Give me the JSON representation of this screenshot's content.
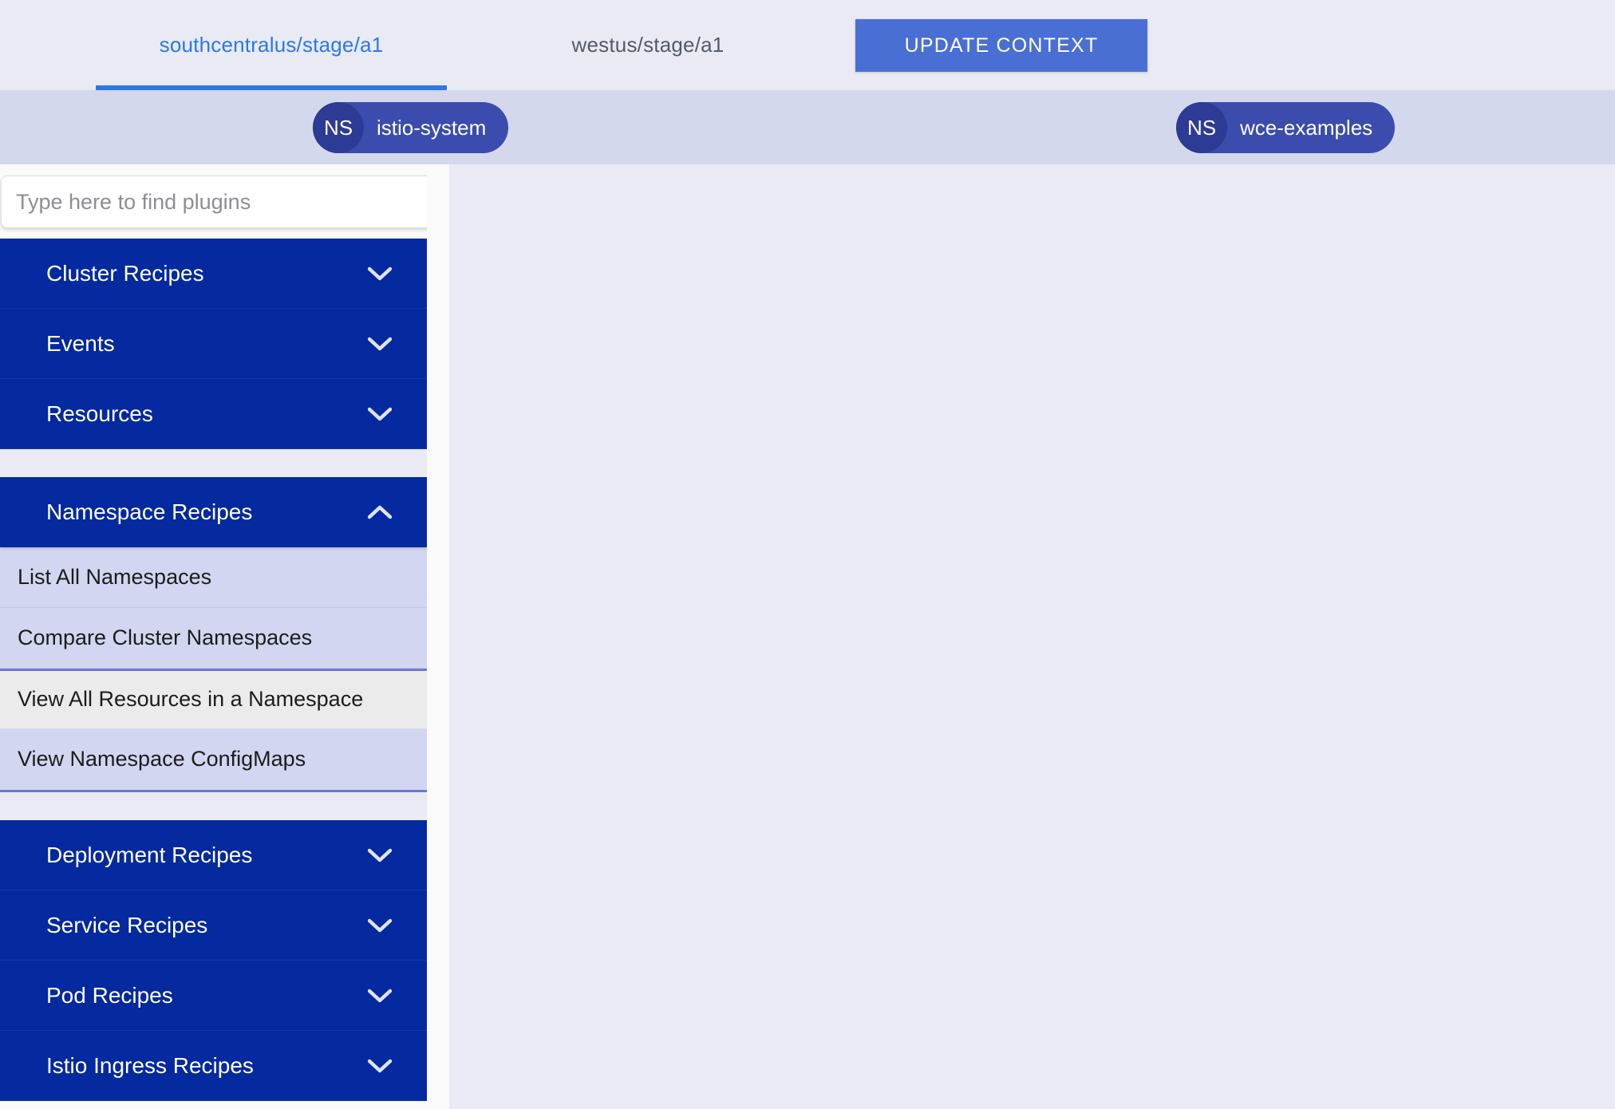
{
  "tabs": [
    {
      "label": "southcentralus/stage/a1",
      "active": true
    },
    {
      "label": "westus/stage/a1",
      "active": false
    }
  ],
  "toolbar": {
    "update_context_label": "UPDATE CONTEXT"
  },
  "namespace_bar": {
    "chips": [
      {
        "avatar": "NS",
        "label": "istio-system"
      },
      {
        "avatar": "NS",
        "label": "wce-examples"
      }
    ]
  },
  "sidebar": {
    "search": {
      "placeholder": "Type here to find plugins",
      "value": ""
    },
    "groups": [
      {
        "label": "Cluster Recipes",
        "expanded": false,
        "chevron": "chevron-down-icon",
        "items": []
      },
      {
        "label": "Events",
        "expanded": false,
        "chevron": "chevron-down-icon",
        "items": []
      },
      {
        "label": "Resources",
        "expanded": false,
        "chevron": "chevron-down-icon",
        "items": []
      },
      {
        "label": "Namespace Recipes",
        "expanded": true,
        "chevron": "chevron-up-icon",
        "items": [
          {
            "label": "List All Namespaces",
            "hovered": false
          },
          {
            "label": "Compare Cluster Namespaces",
            "hovered": false
          },
          {
            "label": "View All Resources in a Namespace",
            "hovered": true
          },
          {
            "label": "View Namespace ConfigMaps",
            "hovered": false
          }
        ]
      },
      {
        "label": "Deployment Recipes",
        "expanded": false,
        "chevron": "chevron-down-icon",
        "items": []
      },
      {
        "label": "Service Recipes",
        "expanded": false,
        "chevron": "chevron-down-icon",
        "items": []
      },
      {
        "label": "Pod Recipes",
        "expanded": false,
        "chevron": "chevron-down-icon",
        "items": []
      },
      {
        "label": "Istio Ingress Recipes",
        "expanded": false,
        "chevron": "chevron-down-icon",
        "items": []
      }
    ]
  },
  "colors": {
    "page_background": "#eaeaf4",
    "accent_blue": "#2979e8",
    "button_blue": "#4a6fd4",
    "accordion_blue": "#05299e",
    "chip_blue": "#3b4cae",
    "chip_avatar_blue": "#2d3b94",
    "subitem_lavender": "#d2d6f0",
    "subitem_hover_gray": "#ebebeb",
    "ns_bar_lavender": "#d4d8ec",
    "inactive_tab_text": "#545a6b"
  }
}
